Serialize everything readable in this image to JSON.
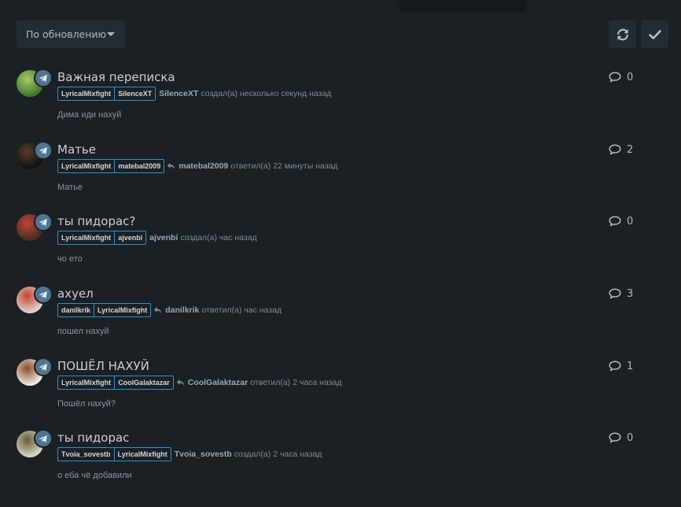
{
  "toolbar": {
    "sort_label": "По обновлению",
    "refresh_icon": "refresh-icon",
    "check_icon": "check-icon"
  },
  "topics": [
    {
      "title": "Важная переписка",
      "tags": [
        "LyricalMixfight",
        "SilenceXT"
      ],
      "reply_icon": false,
      "author": "SilenceXT",
      "action": "создал(а) несколько секунд назад",
      "preview": "Дима иди нахуй",
      "count": "0",
      "avatar_colors": [
        "#3f7a2a",
        "#a9c86a"
      ]
    },
    {
      "title": "Матье",
      "tags": [
        "LyricalMixfight",
        "matebal2009"
      ],
      "reply_icon": true,
      "author": "matebal2009",
      "action": "ответил(а) 22 минуты назад",
      "preview": "Матье",
      "count": "2",
      "avatar_colors": [
        "#111111",
        "#5a3d2b"
      ]
    },
    {
      "title": "ты пидорас?",
      "tags": [
        "LyricalMixfight",
        "ajvenbi"
      ],
      "reply_icon": false,
      "author": "ajvenbi",
      "action": "создал(а) час назад",
      "preview": "чо ето",
      "count": "0",
      "avatar_colors": [
        "#4a2a20",
        "#c0463a"
      ]
    },
    {
      "title": "ахуел",
      "tags": [
        "danilkrik",
        "LyricalMixfight"
      ],
      "reply_icon": true,
      "author": "danilkrik",
      "action": "ответил(а) час назад",
      "preview": "пошел нахуй",
      "count": "3",
      "avatar_colors": [
        "#d9d4cf",
        "#c6442f"
      ]
    },
    {
      "title": "ПОШЁЛ НАХУЙ",
      "tags": [
        "LyricalMixfight",
        "CoolGalaktazar"
      ],
      "reply_icon": true,
      "author": "CoolGalaktazar",
      "action": "ответил(а) 2 часа назад",
      "preview": "Пошёл нахуй?",
      "count": "1",
      "avatar_colors": [
        "#efe9e2",
        "#8a4b2a"
      ]
    },
    {
      "title": "ты пидорас",
      "tags": [
        "Tvoia_sovestb",
        "LyricalMixfight"
      ],
      "reply_icon": false,
      "author": "Tvoia_sovestb",
      "action": "создал(а) 2 часа назад",
      "preview": "о еба чё добавили",
      "count": "0",
      "avatar_colors": [
        "#d8d4c4",
        "#6b5a3a"
      ]
    }
  ],
  "colors": {
    "background": "#1b2024",
    "tag_border": "#2f8fc9",
    "telegram_badge": "#4f7690"
  },
  "icons": {
    "badge": "telegram-icon",
    "reply": "reply-icon",
    "comments": "comment-icon"
  }
}
